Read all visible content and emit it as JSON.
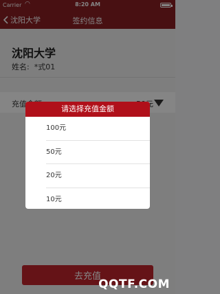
{
  "status_bar": {
    "carrier": "Carrier",
    "time": "8:20 AM"
  },
  "nav": {
    "back_label": "沈阳大学",
    "title": "签约信息"
  },
  "profile": {
    "school_name": "沈阳大学",
    "name_label": "姓名:",
    "name_value": "*式01"
  },
  "recharge": {
    "amount_label": "充值金额:",
    "amount_value": "50元"
  },
  "submit_label": "去充值",
  "dialog": {
    "title": "请选择充值金额",
    "options": [
      "100元",
      "50元",
      "20元",
      "10元"
    ]
  },
  "watermark": "QQTF.COM",
  "colors": {
    "nav_bg": "#8a1f24",
    "dialog_header": "#b0101a",
    "button_bg": "#c2262d"
  }
}
